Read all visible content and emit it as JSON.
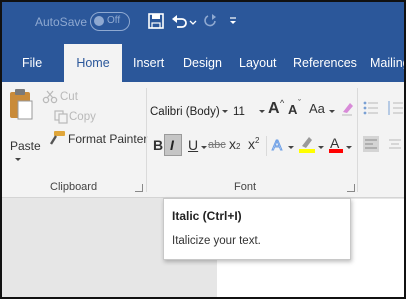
{
  "titlebar": {
    "autosave_label": "AutoSave",
    "autosave_state": "Off"
  },
  "tabs": [
    {
      "label": "File"
    },
    {
      "label": "Home"
    },
    {
      "label": "Insert"
    },
    {
      "label": "Design"
    },
    {
      "label": "Layout"
    },
    {
      "label": "References"
    },
    {
      "label": "Mailings"
    }
  ],
  "clipboard": {
    "paste_label": "Paste",
    "cut_label": "Cut",
    "copy_label": "Copy",
    "format_painter_label": "Format Painter",
    "group_label": "Clipboard"
  },
  "font": {
    "font_name": "Calibri (Body)",
    "font_size": "11",
    "change_case_label": "Aa",
    "bold": "B",
    "italic": "I",
    "underline": "U",
    "strikethrough": "abc",
    "subscript": "x",
    "superscript": "x",
    "group_label": "Font"
  },
  "tooltip": {
    "title": "Italic (Ctrl+I)",
    "description": "Italicize your text."
  },
  "colors": {
    "accent": "#2b579a",
    "ribbon_bg": "#f3f3f3",
    "highlight": "#ffff00",
    "font_color": "#ff0000"
  }
}
